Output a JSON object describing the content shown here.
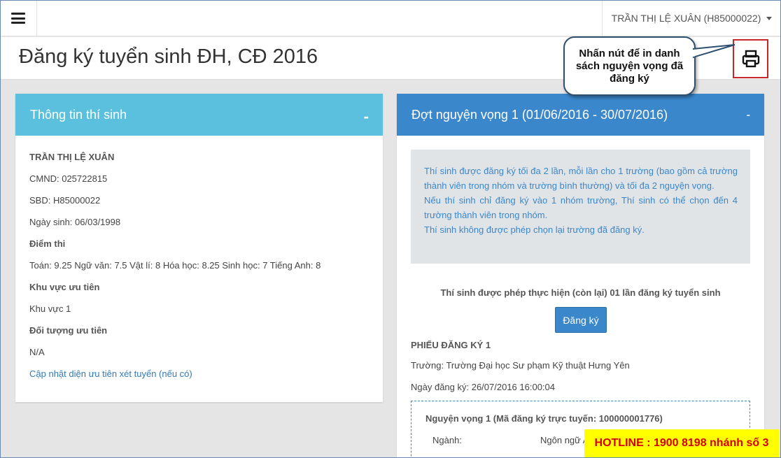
{
  "header": {
    "user_label": "TRẦN THỊ LỆ XUÂN (H85000022)"
  },
  "page": {
    "title": "Đăng ký tuyển sinh ĐH, CĐ 2016",
    "print_icon": "printer-icon"
  },
  "callout": {
    "text": "Nhấn nút để in danh sách nguyện vọng đã đăng ký"
  },
  "left_panel": {
    "title": "Thông tin thí sinh",
    "collapse": "-",
    "name": "TRẦN THỊ LỆ XUÂN",
    "cmnd": "CMND: 025722815",
    "sbd": "SBD: H85000022",
    "dob": "Ngày sinh: 06/03/1998",
    "scores_heading": "Điểm thi",
    "scores": "Toán: 9.25 Ngữ văn: 7.5 Vật lí: 8 Hóa học: 8.25 Sinh học: 7 Tiếng Anh: 8",
    "region_heading": "Khu vực ưu tiên",
    "region": "Khu vực 1",
    "priority_heading": "Đối tượng ưu tiên",
    "priority": "N/A",
    "update_link": "Cập nhật diện ưu tiên xét tuyển (nếu có)"
  },
  "right_panel": {
    "title": "Đợt nguyện vọng 1 (01/06/2016 - 30/07/2016)",
    "collapse": "-",
    "notice_1": "Thí sinh được đăng ký tối đa 2 lần, mỗi lần cho 1 trường (bao gồm cả trường thành viên trong nhóm và trường bình thường) và tối đa 2 nguyện vọng.",
    "notice_2": "Nếu thí sinh chỉ đăng ký vào 1 nhóm trường, Thí sinh có thể chọn đến 4 trường thành viên trong nhóm.",
    "notice_3": "Thí sinh không được phép chọn lại trường đã đăng ký.",
    "remain_text": "Thí sinh được phép thực hiện (còn lại) 01 lần đăng ký tuyển sinh",
    "register_button": "Đăng ký",
    "form_heading": "PHIẾU ĐĂNG KÝ 1",
    "school": "Trường: Trường Đại học Sư phạm Kỹ thuật Hưng Yên",
    "reg_date": "Ngày đăng ký: 26/07/2016 16:00:04",
    "wish_heading": "Nguyện vọng 1 (Mã đăng ký trực tuyến: 100000001776)",
    "major_label": "Ngành:",
    "major_value": "Ngôn ngữ A"
  },
  "hotline": {
    "text": "HOTLINE : 1900 8198 nhánh số 3"
  }
}
